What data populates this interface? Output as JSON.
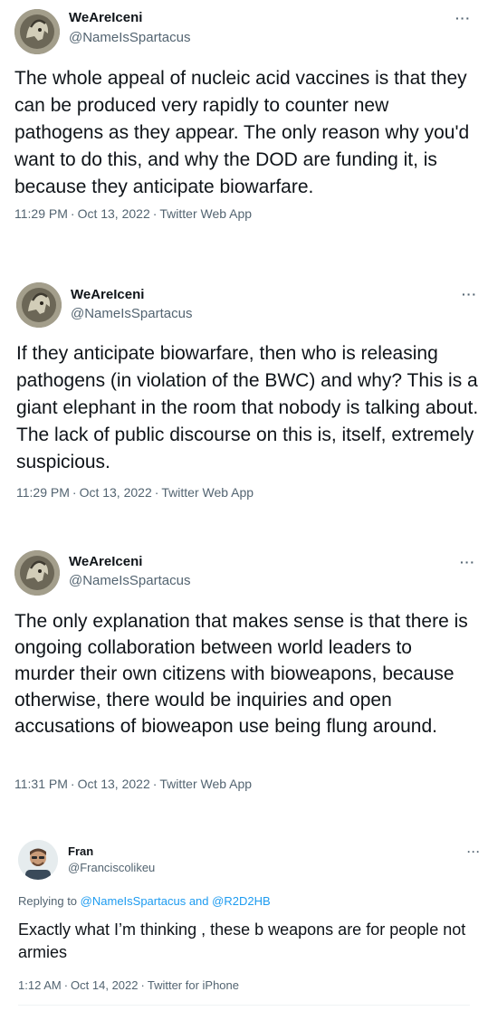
{
  "tweets": [
    {
      "name": "WeAreIceni",
      "handle": "@NameIsSpartacus",
      "text": "The whole appeal of nucleic acid vaccines is that they can be produced very rapidly to counter new pathogens as they appear. The only reason why you'd want to do this, and why the DOD are funding it, is because they anticipate biowarfare.",
      "time": "11:29 PM",
      "date": "Oct 13, 2022",
      "source": "Twitter Web App",
      "more": "···"
    },
    {
      "name": "WeAreIceni",
      "handle": "@NameIsSpartacus",
      "text": "If they anticipate biowarfare, then who is releasing pathogens (in violation of the BWC) and why? This is a giant elephant in the room that nobody is talking about. The lack of public discourse on this is, itself, extremely suspicious.",
      "time": "11:29 PM",
      "date": "Oct 13, 2022",
      "source": "Twitter Web App",
      "more": "···"
    },
    {
      "name": "WeAreIceni",
      "handle": "@NameIsSpartacus",
      "text": "The only explanation that makes sense is that there is ongoing collaboration between world leaders to murder their own citizens with bioweapons, because otherwise, there would be inquiries and open accusations of bioweapon use being flung around.",
      "time": "11:31 PM",
      "date": "Oct 13, 2022",
      "source": "Twitter Web App",
      "more": "···"
    },
    {
      "name": "Fran",
      "handle": "@Franciscolikeu",
      "replying_prefix": "Replying to",
      "replying_user1": "@NameIsSpartacus",
      "replying_and": "and",
      "replying_user2": "@R2D2HB",
      "text": "Exactly what I’m thinking , these b weapons are for people not armies",
      "time": "1:12 AM",
      "date": "Oct 14, 2022",
      "source": "Twitter for iPhone",
      "more": "···"
    }
  ],
  "separator": "·"
}
